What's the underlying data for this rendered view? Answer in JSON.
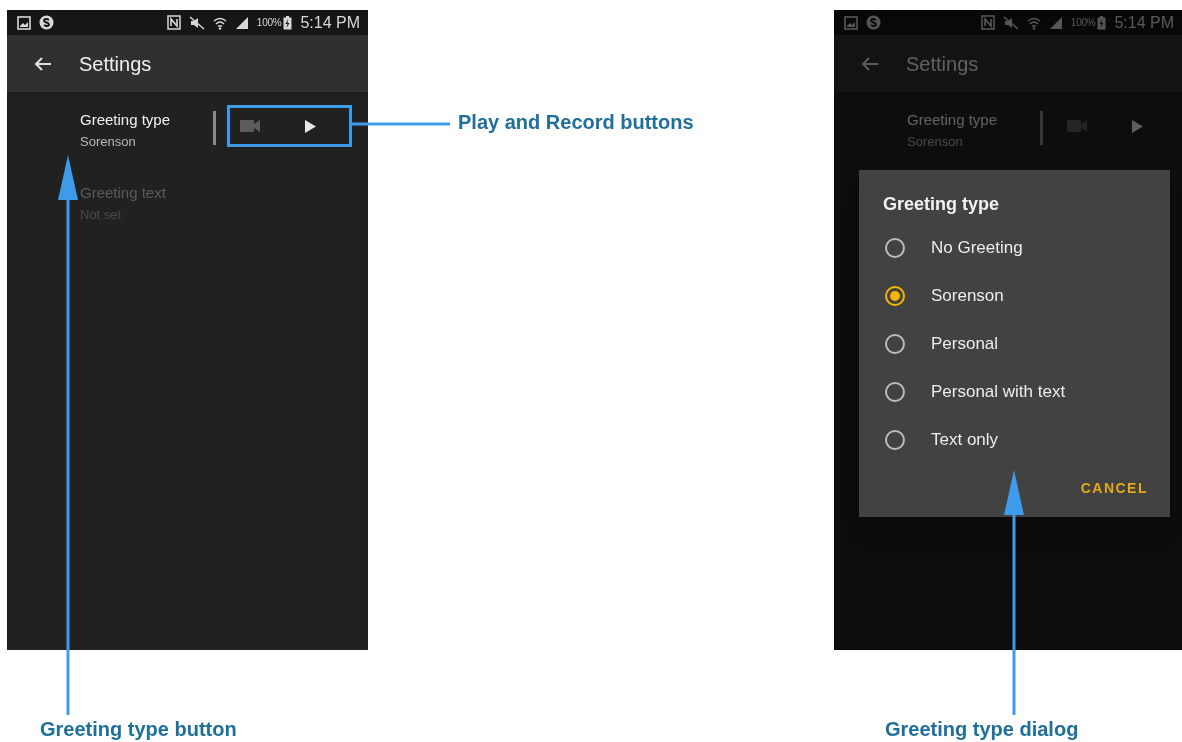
{
  "screens": [
    {
      "dimmed": false,
      "status_bar": {
        "battery": "100%",
        "time": "5:14 PM"
      },
      "app_bar": {
        "title": "Settings"
      },
      "settings": [
        {
          "title": "Greeting type",
          "summary": "Sorenson",
          "disabled": false,
          "media_buttons": true,
          "highlighted": true
        },
        {
          "title": "Greeting text",
          "summary": "Not set",
          "disabled": true,
          "media_buttons": false
        }
      ]
    },
    {
      "dimmed": true,
      "status_bar": {
        "battery": "100%",
        "time": "5:14 PM"
      },
      "app_bar": {
        "title": "Settings"
      },
      "settings": [
        {
          "title": "Greeting type",
          "summary": "Sorenson",
          "disabled": false,
          "media_buttons": true,
          "highlighted": false
        }
      ],
      "dialog": {
        "title": "Greeting type",
        "options": [
          {
            "label": "No Greeting",
            "selected": false
          },
          {
            "label": "Sorenson",
            "selected": true
          },
          {
            "label": "Personal",
            "selected": false
          },
          {
            "label": "Personal with text",
            "selected": false
          },
          {
            "label": "Text only",
            "selected": false
          }
        ],
        "cancel": "CANCEL"
      }
    }
  ],
  "callouts": [
    {
      "kind": "right",
      "text": "Play and Record buttons"
    },
    {
      "kind": "left-up",
      "text": "Greeting type button"
    },
    {
      "kind": "right-up",
      "text": "Greeting type dialog"
    }
  ]
}
